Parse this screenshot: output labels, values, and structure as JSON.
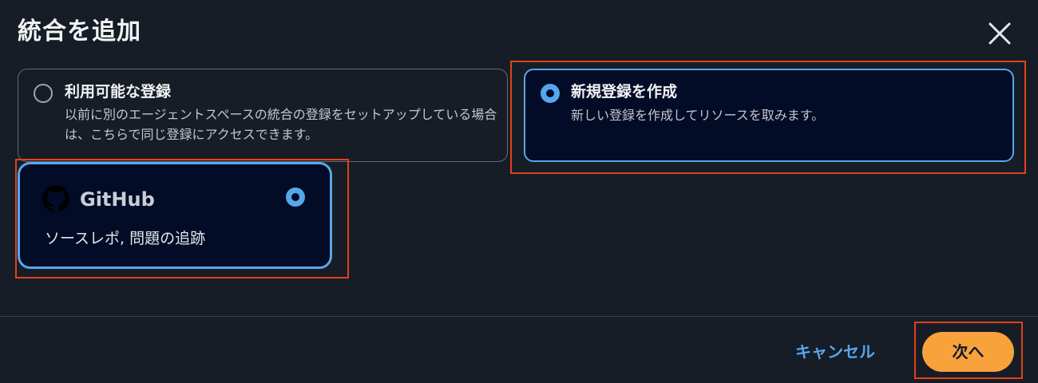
{
  "dialog": {
    "title": "統合を追加",
    "close_icon": "close-icon"
  },
  "options": {
    "existing": {
      "label": "利用可能な登録",
      "description": "以前に別のエージェントスペースの統合の登録をセットアップしている場合は、こちらで同じ登録にアクセスできます。",
      "selected": false
    },
    "new": {
      "label": "新規登録を作成",
      "description": "新しい登録を作成してリソースを取みます。",
      "selected": true
    }
  },
  "provider": {
    "name": "GitHub",
    "description": "ソースレポ, 問題の追跡",
    "icon": "github-icon",
    "selected": true
  },
  "footer": {
    "cancel_label": "キャンセル",
    "next_label": "次へ"
  },
  "colors": {
    "background": "#161d26",
    "card_selected_bg": "#020c26",
    "accent_blue": "#56a6ec",
    "primary_orange": "#f7a23b",
    "highlight_red": "#e2411b"
  }
}
